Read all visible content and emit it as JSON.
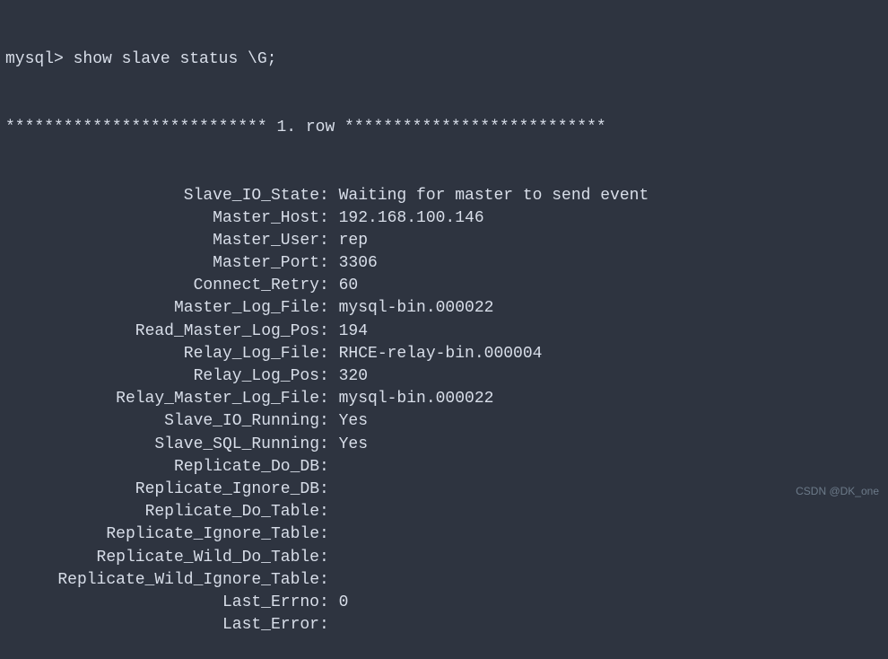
{
  "prompt": "mysql> ",
  "command": "show slave status \\G;",
  "row_header": "*************************** 1. row ***************************",
  "fields": [
    {
      "label": "Slave_IO_State",
      "value": "Waiting for master to send event"
    },
    {
      "label": "Master_Host",
      "value": "192.168.100.146"
    },
    {
      "label": "Master_User",
      "value": "rep"
    },
    {
      "label": "Master_Port",
      "value": "3306"
    },
    {
      "label": "Connect_Retry",
      "value": "60"
    },
    {
      "label": "Master_Log_File",
      "value": "mysql-bin.000022"
    },
    {
      "label": "Read_Master_Log_Pos",
      "value": "194"
    },
    {
      "label": "Relay_Log_File",
      "value": "RHCE-relay-bin.000004"
    },
    {
      "label": "Relay_Log_Pos",
      "value": "320"
    },
    {
      "label": "Relay_Master_Log_File",
      "value": "mysql-bin.000022"
    },
    {
      "label": "Slave_IO_Running",
      "value": "Yes"
    },
    {
      "label": "Slave_SQL_Running",
      "value": "Yes"
    },
    {
      "label": "Replicate_Do_DB",
      "value": ""
    },
    {
      "label": "Replicate_Ignore_DB",
      "value": ""
    },
    {
      "label": "Replicate_Do_Table",
      "value": ""
    },
    {
      "label": "Replicate_Ignore_Table",
      "value": ""
    },
    {
      "label": "Replicate_Wild_Do_Table",
      "value": ""
    },
    {
      "label": "Replicate_Wild_Ignore_Table",
      "value": ""
    },
    {
      "label": "Last_Errno",
      "value": "0"
    },
    {
      "label": "Last_Error",
      "value": ""
    }
  ],
  "watermark": "CSDN @DK_one"
}
